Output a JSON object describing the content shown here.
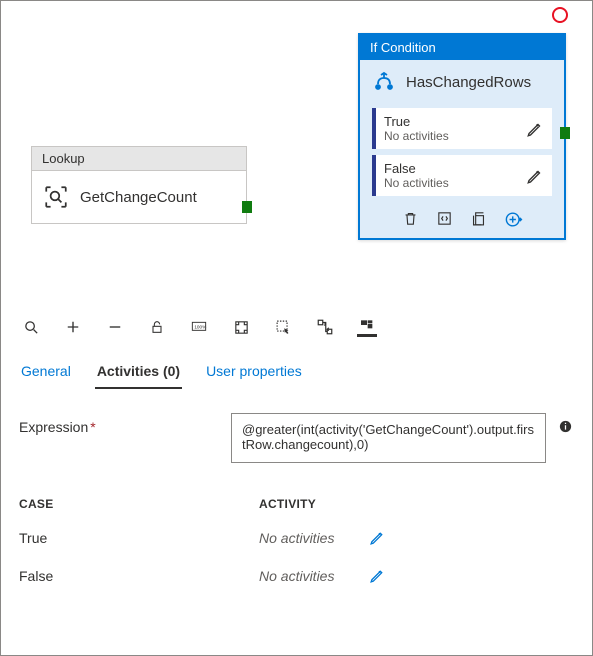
{
  "lookup": {
    "title": "Lookup",
    "name": "GetChangeCount"
  },
  "ifcond": {
    "title": "If Condition",
    "name": "HasChangedRows",
    "branches": [
      {
        "label": "True",
        "sub": "No activities"
      },
      {
        "label": "False",
        "sub": "No activities"
      }
    ]
  },
  "tabs": {
    "general": "General",
    "activities": "Activities (0)",
    "user_props": "User properties"
  },
  "form": {
    "expression_label": "Expression",
    "expression_value": "@greater(int(activity('GetChangeCount').output.firstRow.changecount),0)"
  },
  "table": {
    "head_case": "CASE",
    "head_activity": "ACTIVITY",
    "rows": [
      {
        "case": "True",
        "activity": "No activities"
      },
      {
        "case": "False",
        "activity": "No activities"
      }
    ]
  }
}
